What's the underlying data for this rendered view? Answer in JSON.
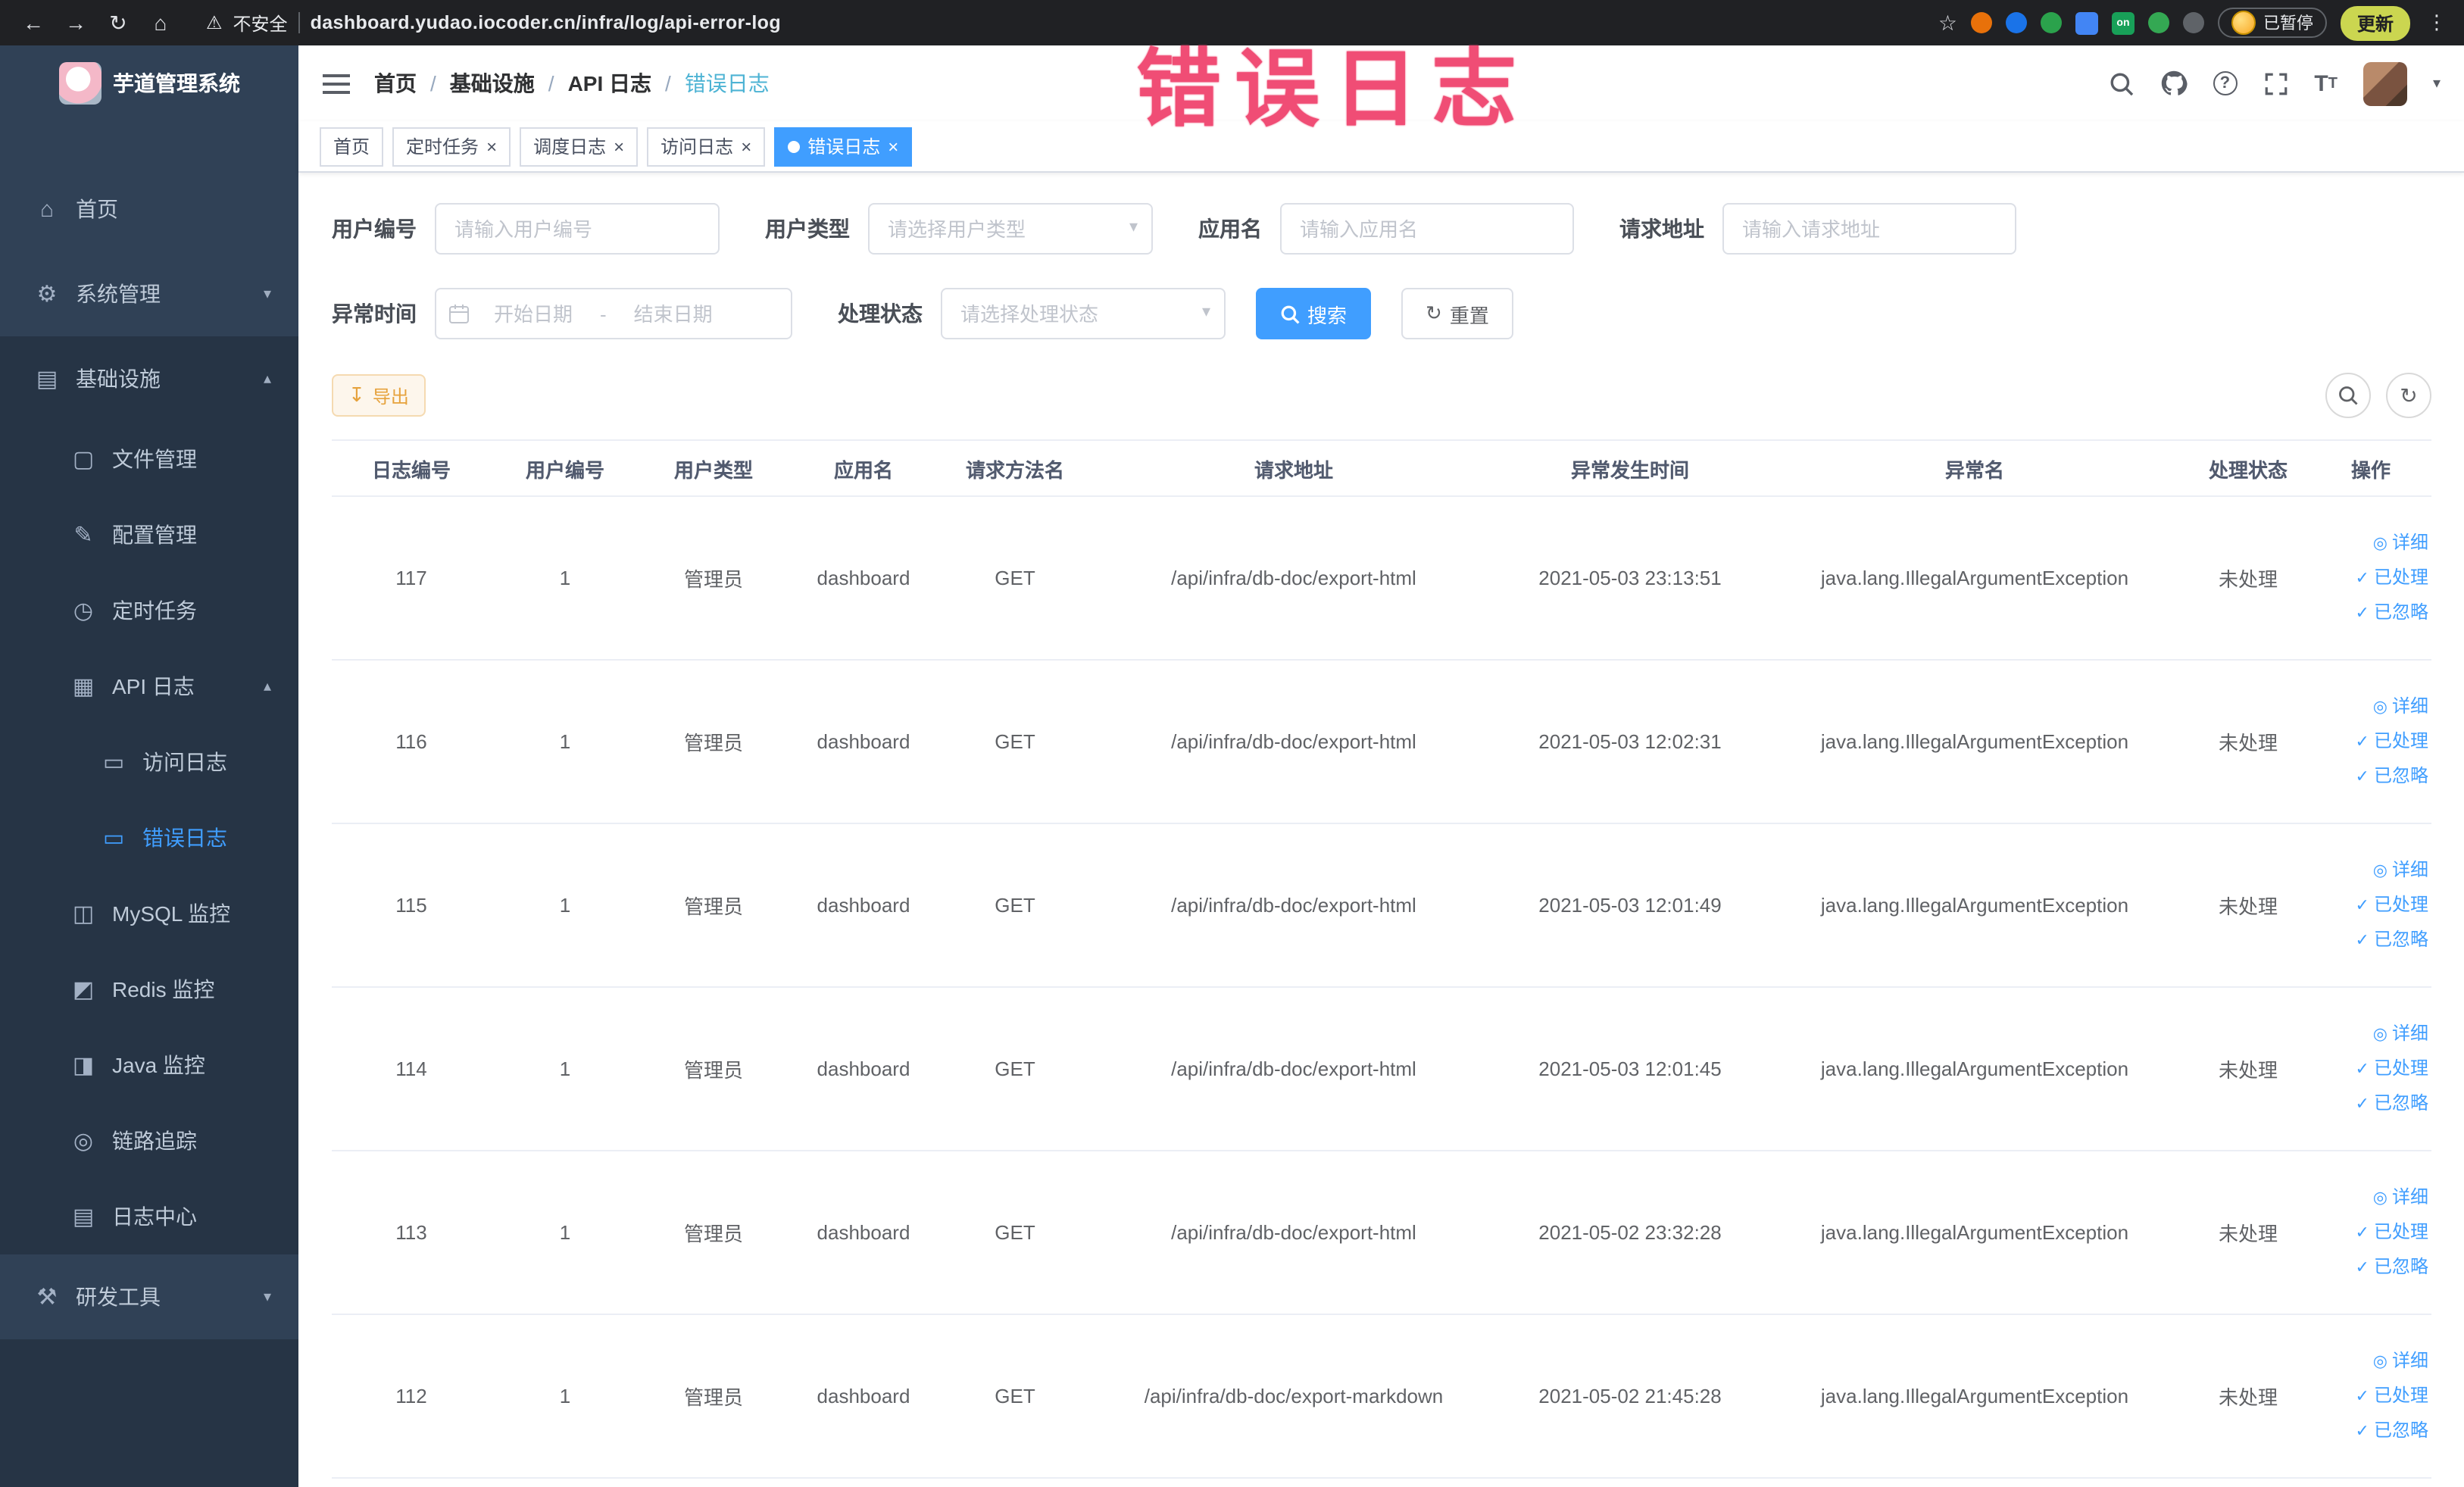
{
  "browser": {
    "not_secure": "不安全",
    "url": "dashboard.yudao.iocoder.cn/infra/log/api-error-log",
    "extension_on_badge": "on",
    "paused_badge": "已暂停",
    "update_button": "更新"
  },
  "annotation": {
    "text": "错误日志"
  },
  "sidebar": {
    "logo_title": "芋道管理系统",
    "items": [
      {
        "id": "home",
        "label": "首页",
        "icon": "home-icon",
        "level": 1
      },
      {
        "id": "system-management",
        "label": "系统管理",
        "icon": "gear-icon",
        "level": 1,
        "chevron": "down"
      },
      {
        "id": "infrastructure",
        "label": "基础设施",
        "icon": "infrastructure-icon",
        "level": 1,
        "chevron": "up",
        "dark": true
      },
      {
        "id": "file-management",
        "label": "文件管理",
        "icon": "file-icon",
        "level": 2,
        "dark": true
      },
      {
        "id": "config-management",
        "label": "配置管理",
        "icon": "config-icon",
        "level": 2,
        "dark": true
      },
      {
        "id": "scheduled-tasks",
        "label": "定时任务",
        "icon": "timer-icon",
        "level": 2,
        "dark": true
      },
      {
        "id": "api-log",
        "label": "API 日志",
        "icon": "api-log-icon",
        "level": 2,
        "chevron": "up",
        "dark": true
      },
      {
        "id": "access-log",
        "label": "访问日志",
        "icon": "doc-icon",
        "level": 3,
        "dark": true
      },
      {
        "id": "error-log",
        "label": "错误日志",
        "icon": "doc-icon",
        "level": 3,
        "dark": true,
        "active": true
      },
      {
        "id": "mysql-monitor",
        "label": "MySQL 监控",
        "icon": "mysql-icon",
        "level": 2,
        "dark": true
      },
      {
        "id": "redis-monitor",
        "label": "Redis 监控",
        "icon": "redis-icon",
        "level": 2,
        "dark": true
      },
      {
        "id": "java-monitor",
        "label": "Java 监控",
        "icon": "java-icon",
        "level": 2,
        "dark": true
      },
      {
        "id": "trace",
        "label": "链路追踪",
        "icon": "trace-icon",
        "level": 2,
        "dark": true
      },
      {
        "id": "log-center",
        "label": "日志中心",
        "icon": "log-center-icon",
        "level": 2,
        "dark": true
      },
      {
        "id": "dev-tools",
        "label": "研发工具",
        "icon": "tools-icon",
        "level": 1,
        "chevron": "down"
      }
    ]
  },
  "header": {
    "breadcrumb": [
      "首页",
      "基础设施",
      "API 日志",
      "错误日志"
    ],
    "separator": "/"
  },
  "tabs": [
    {
      "id": "home",
      "label": "首页",
      "active": false,
      "closable": false
    },
    {
      "id": "scheduled-tasks",
      "label": "定时任务",
      "active": false,
      "closable": true
    },
    {
      "id": "schedule-log",
      "label": "调度日志",
      "active": false,
      "closable": true
    },
    {
      "id": "access-log",
      "label": "访问日志",
      "active": false,
      "closable": true
    },
    {
      "id": "error-log",
      "label": "错误日志",
      "active": true,
      "closable": true
    }
  ],
  "filters": {
    "user_id_label": "用户编号",
    "user_id_placeholder": "请输入用户编号",
    "user_type_label": "用户类型",
    "user_type_placeholder": "请选择用户类型",
    "app_name_label": "应用名",
    "app_name_placeholder": "请输入应用名",
    "request_url_label": "请求地址",
    "request_url_placeholder": "请输入请求地址",
    "exception_time_label": "异常时间",
    "start_date_placeholder": "开始日期",
    "end_date_placeholder": "结束日期",
    "date_separator": "-",
    "process_status_label": "处理状态",
    "process_status_placeholder": "请选择处理状态",
    "search_button": "搜索",
    "reset_button": "重置"
  },
  "toolbar": {
    "export_button": "导出"
  },
  "table": {
    "headers": [
      "日志编号",
      "用户编号",
      "用户类型",
      "应用名",
      "请求方法名",
      "请求地址",
      "异常发生时间",
      "异常名",
      "处理状态",
      "操作"
    ],
    "actions": {
      "detail": "详细",
      "processed": "已处理",
      "ignored": "已忽略"
    },
    "rows": [
      {
        "log_id": "117",
        "user_id": "1",
        "user_type": "管理员",
        "app": "dashboard",
        "method": "GET",
        "url": "/api/infra/db-doc/export-html",
        "time": "2021-05-03 23:13:51",
        "exception": "java.lang.IllegalArgumentException",
        "status": "未处理"
      },
      {
        "log_id": "116",
        "user_id": "1",
        "user_type": "管理员",
        "app": "dashboard",
        "method": "GET",
        "url": "/api/infra/db-doc/export-html",
        "time": "2021-05-03 12:02:31",
        "exception": "java.lang.IllegalArgumentException",
        "status": "未处理"
      },
      {
        "log_id": "115",
        "user_id": "1",
        "user_type": "管理员",
        "app": "dashboard",
        "method": "GET",
        "url": "/api/infra/db-doc/export-html",
        "time": "2021-05-03 12:01:49",
        "exception": "java.lang.IllegalArgumentException",
        "status": "未处理"
      },
      {
        "log_id": "114",
        "user_id": "1",
        "user_type": "管理员",
        "app": "dashboard",
        "method": "GET",
        "url": "/api/infra/db-doc/export-html",
        "time": "2021-05-03 12:01:45",
        "exception": "java.lang.IllegalArgumentException",
        "status": "未处理"
      },
      {
        "log_id": "113",
        "user_id": "1",
        "user_type": "管理员",
        "app": "dashboard",
        "method": "GET",
        "url": "/api/infra/db-doc/export-html",
        "time": "2021-05-02 23:32:28",
        "exception": "java.lang.IllegalArgumentException",
        "status": "未处理"
      },
      {
        "log_id": "112",
        "user_id": "1",
        "user_type": "管理员",
        "app": "dashboard",
        "method": "GET",
        "url": "/api/infra/db-doc/export-markdown",
        "time": "2021-05-02 21:45:28",
        "exception": "java.lang.IllegalArgumentException",
        "status": "未处理"
      }
    ]
  }
}
